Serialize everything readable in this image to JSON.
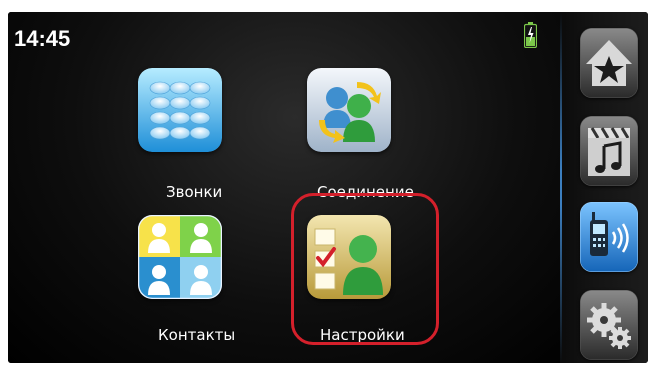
{
  "status_bar": {
    "time": "14:45",
    "battery_icon": "battery-charging-icon"
  },
  "menu": {
    "tiles": [
      {
        "label": "Звонки",
        "icon": "dialpad-icon"
      },
      {
        "label": "Соединение",
        "icon": "connection-icon"
      },
      {
        "label": "Контакты",
        "icon": "contacts-icon"
      },
      {
        "label": "Настройки",
        "icon": "settings-profile-icon"
      }
    ]
  },
  "sidebar": {
    "buttons": [
      {
        "icon": "home-star-icon",
        "active": false
      },
      {
        "icon": "media-icon",
        "active": false
      },
      {
        "icon": "phone-icon",
        "active": true
      },
      {
        "icon": "gears-icon",
        "active": false
      }
    ]
  },
  "colors": {
    "highlight": "#d4202b",
    "active_side": "#2a7fd4"
  }
}
